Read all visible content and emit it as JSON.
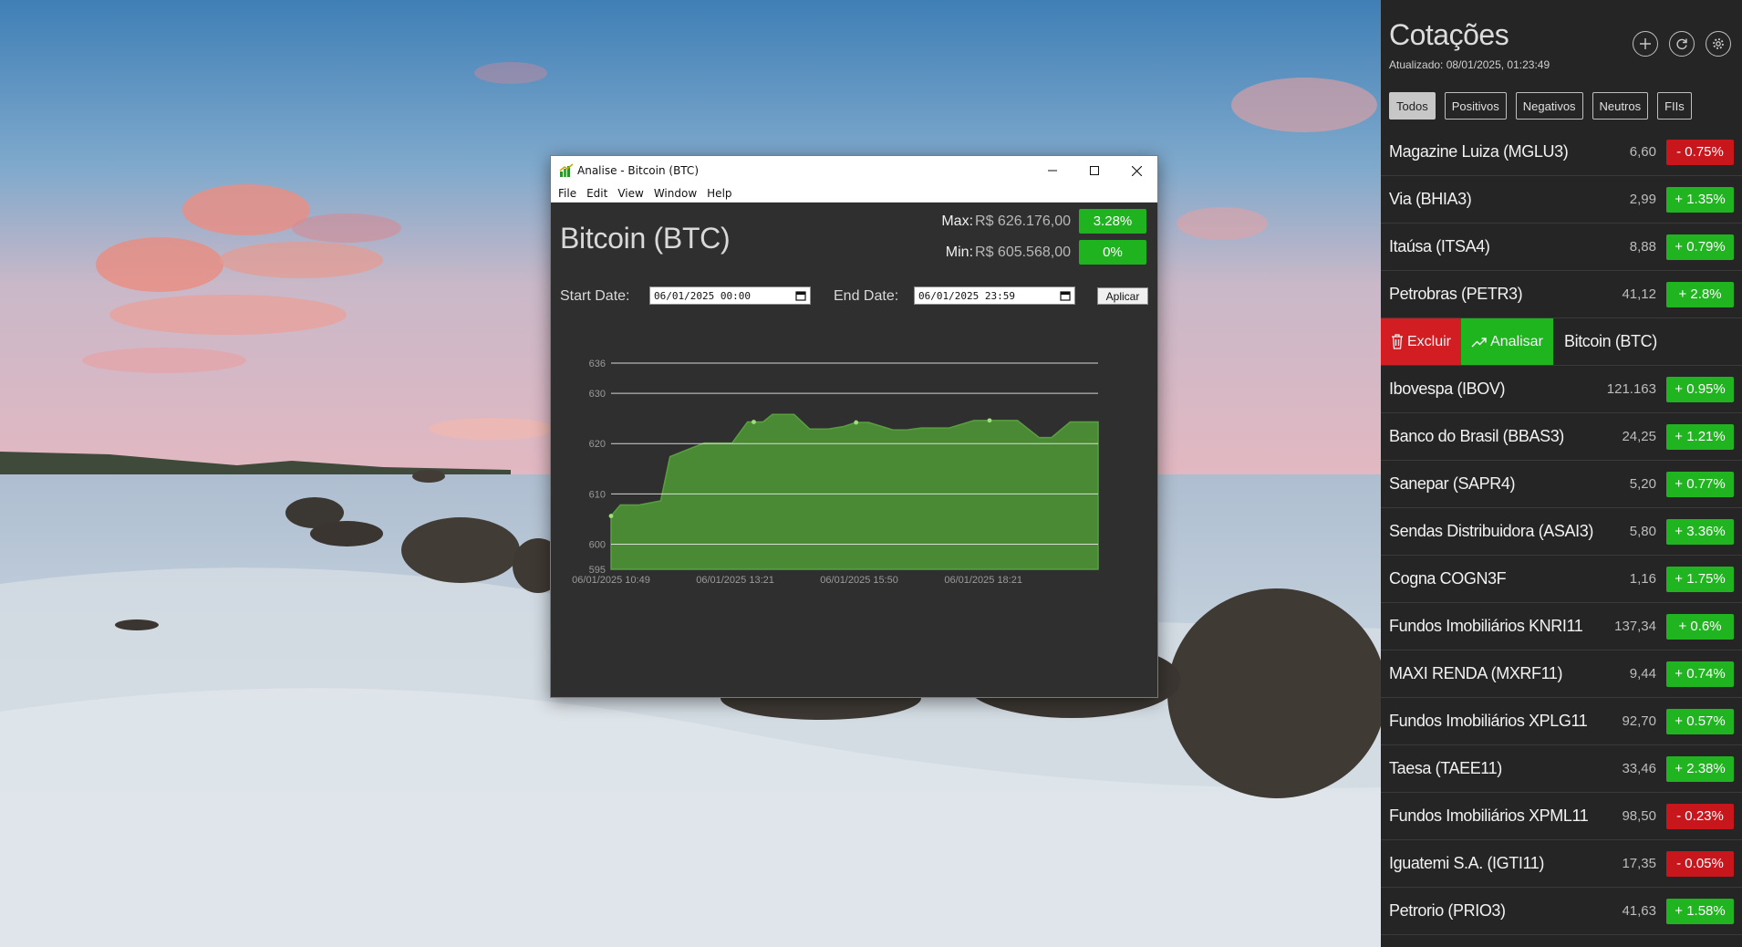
{
  "window": {
    "title": "Analise - Bitcoin (BTC)",
    "menu": [
      "File",
      "Edit",
      "View",
      "Window",
      "Help"
    ],
    "asset_title": "Bitcoin (BTC)",
    "max": {
      "label": "Max:",
      "value": "R$ 626.176,00",
      "badge": "3.28%"
    },
    "min": {
      "label": "Min:",
      "value": "R$ 605.568,00",
      "badge": "0%"
    },
    "start_label": "Start Date:",
    "start_value": "06/01/2025 00:00",
    "end_label": "End Date:",
    "end_value": "06/01/2025 23:59",
    "apply_label": "Aplicar"
  },
  "chart_data": {
    "type": "area",
    "title": "",
    "xlabel": "",
    "ylabel": "",
    "ylim": [
      595,
      636
    ],
    "y_ticks": [
      595,
      600,
      610,
      620,
      630,
      636
    ],
    "x_ticks": [
      "06/01/2025 10:49",
      "06/01/2025 13:21",
      "06/01/2025 15:50",
      "06/01/2025 18:21"
    ],
    "x_tick_positions": [
      0,
      4,
      8,
      12
    ],
    "color": "#4b8a35",
    "x": [
      0,
      0.3,
      0.9,
      1.6,
      1.9,
      3.0,
      3.9,
      4.4,
      4.6,
      4.9,
      5.2,
      5.9,
      6.4,
      7.0,
      7.5,
      7.9,
      8.3,
      9.1,
      9.5,
      10.0,
      10.9,
      11.7,
      12.2,
      13.1,
      13.8,
      14.2,
      14.8,
      15.7
    ],
    "y": [
      605.6,
      607.8,
      607.8,
      608.6,
      617.4,
      620.1,
      620.1,
      624.3,
      624.3,
      624.3,
      625.8,
      625.8,
      622.9,
      622.9,
      623.4,
      624.2,
      624.2,
      622.7,
      622.7,
      623.1,
      623.1,
      624.6,
      624.6,
      624.6,
      621.2,
      621.2,
      624.3,
      624.3
    ],
    "markers": [
      0,
      8,
      15,
      22
    ]
  },
  "panel": {
    "title": "Cotações",
    "updated": "Atualizado: 08/01/2025, 01:23:49",
    "icons": [
      "plus-icon",
      "refresh-icon",
      "gear-icon"
    ],
    "filters": [
      "Todos",
      "Positivos",
      "Negativos",
      "Neutros",
      "FIIs"
    ],
    "delete_label": "Excluir",
    "analyze_label": "Analisar",
    "quotes": [
      {
        "name": "Magazine Luiza (MGLU3)",
        "price": "6,60",
        "change": "- 0.75%",
        "positive": false
      },
      {
        "name": "Via (BHIA3)",
        "price": "2,99",
        "change": "+ 1.35%",
        "positive": true
      },
      {
        "name": "Itaúsa (ITSA4)",
        "price": "8,88",
        "change": "+ 0.79%",
        "positive": true
      },
      {
        "name": "Petrobras (PETR3)",
        "price": "41,12",
        "change": "+ 2.8%",
        "positive": true
      },
      {
        "name": "Bitcoin (BTC)",
        "price": "",
        "change": "",
        "positive": true,
        "swiped": true
      },
      {
        "name": "Ibovespa (IBOV)",
        "price": "121.163",
        "change": "+ 0.95%",
        "positive": true
      },
      {
        "name": "Banco do Brasil (BBAS3)",
        "price": "24,25",
        "change": "+ 1.21%",
        "positive": true
      },
      {
        "name": "Sanepar (SAPR4)",
        "price": "5,20",
        "change": "+ 0.77%",
        "positive": true
      },
      {
        "name": "Sendas Distribuidora (ASAI3)",
        "price": "5,80",
        "change": "+ 3.36%",
        "positive": true
      },
      {
        "name": "Cogna COGN3F",
        "price": "1,16",
        "change": "+ 1.75%",
        "positive": true
      },
      {
        "name": "Fundos Imobiliários KNRI11",
        "price": "137,34",
        "change": "+ 0.6%",
        "positive": true
      },
      {
        "name": "MAXI RENDA (MXRF11)",
        "price": "9,44",
        "change": "+ 0.74%",
        "positive": true
      },
      {
        "name": "Fundos Imobiliários XPLG11",
        "price": "92,70",
        "change": "+ 0.57%",
        "positive": true
      },
      {
        "name": "Taesa (TAEE11)",
        "price": "33,46",
        "change": "+ 2.38%",
        "positive": true
      },
      {
        "name": "Fundos Imobiliários XPML11",
        "price": "98,50",
        "change": "- 0.23%",
        "positive": false
      },
      {
        "name": "Iguatemi S.A. (IGTI11)",
        "price": "17,35",
        "change": "- 0.05%",
        "positive": false
      },
      {
        "name": "Petrorio (PRIO3)",
        "price": "41,63",
        "change": "+ 1.58%",
        "positive": true
      }
    ]
  }
}
